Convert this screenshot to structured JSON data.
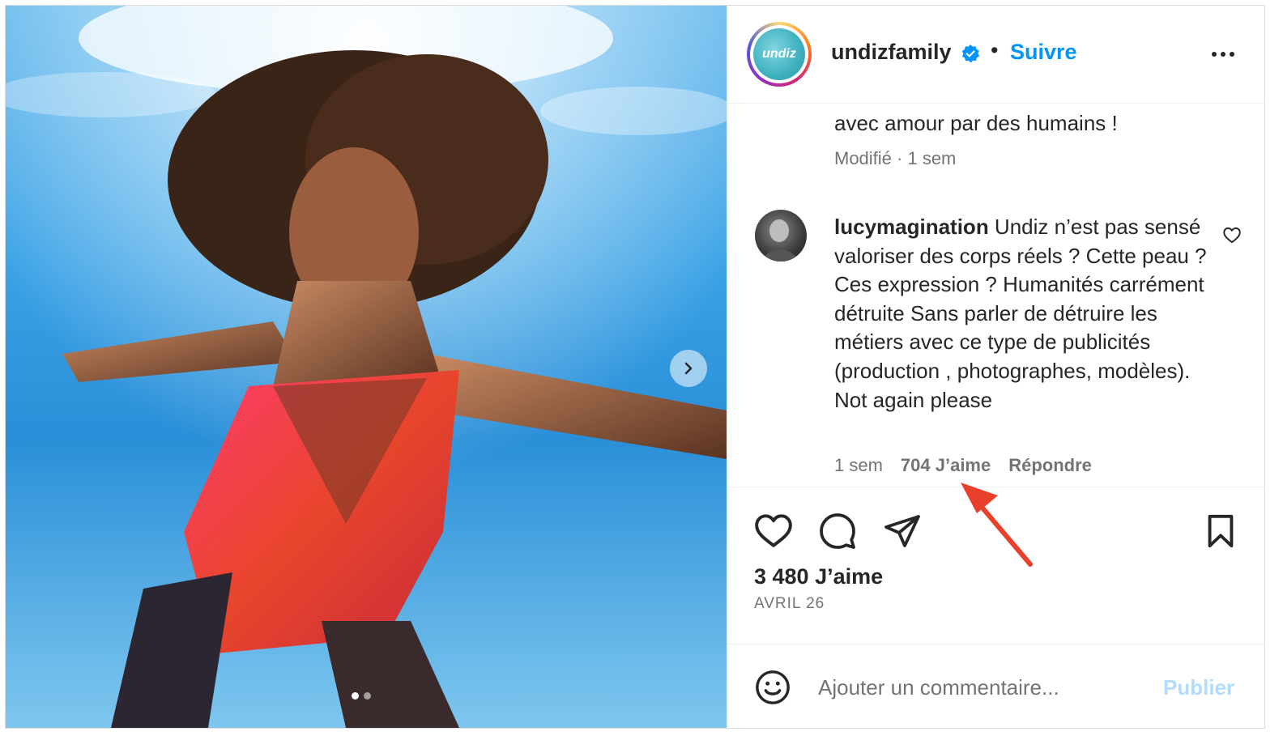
{
  "post": {
    "username": "undizfamily",
    "avatar_text": "undiz",
    "separator": "•",
    "follow_label": "Suivre",
    "verified_icon": "verified-badge-icon",
    "more_icon": "more-options-icon"
  },
  "caption": {
    "tail_text": "avec amour par des humains !",
    "meta": "Modifié · 1 sem"
  },
  "comment": {
    "username": "lucymagination",
    "text": " Undiz n’est pas sensé valoriser des corps réels ? Cette peau ? Ces expression ? Humanités carrément détruite Sans parler de détruire les métiers avec ce type de publicités (production , photographes, modèles). Not again please",
    "age": "1 sem",
    "likes": "704 J’aime",
    "reply_label": "Répondre"
  },
  "actions": {
    "like_icon": "heart-icon",
    "comment_icon": "comment-bubble-icon",
    "share_icon": "paper-plane-icon",
    "save_icon": "bookmark-icon"
  },
  "stats": {
    "likes": "3 480 J’aime",
    "date": "AVRIL 26"
  },
  "composer": {
    "placeholder": "Ajouter un commentaire...",
    "publish_label": "Publier",
    "emoji_icon": "emoji-smile-icon"
  },
  "carousel": {
    "current": 1,
    "total": 2
  },
  "colors": {
    "accent": "#0095f6",
    "publish_disabled": "#b3dbff",
    "annotation_arrow": "#e8402a"
  }
}
